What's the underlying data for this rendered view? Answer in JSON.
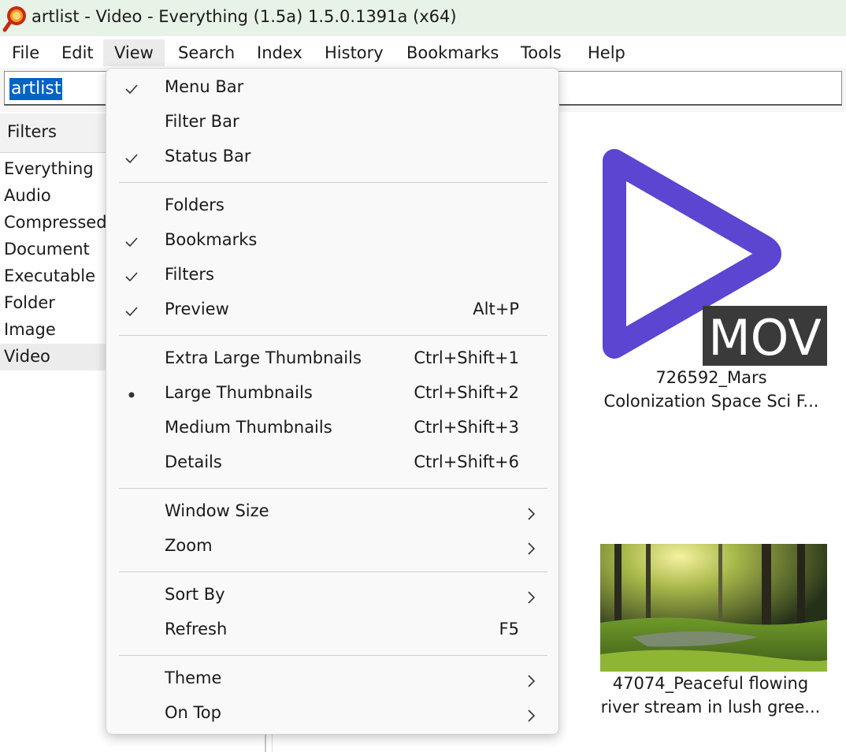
{
  "window": {
    "title": "artlist - Video - Everything (1.5a) 1.5.0.1391a (x64)"
  },
  "menubar": {
    "items": [
      {
        "label": "File"
      },
      {
        "label": "Edit"
      },
      {
        "label": "View"
      },
      {
        "label": "Search"
      },
      {
        "label": "Index"
      },
      {
        "label": "History"
      },
      {
        "label": "Bookmarks"
      },
      {
        "label": "Tools"
      },
      {
        "label": "Help"
      }
    ],
    "active": "View"
  },
  "search": {
    "value": "artlist"
  },
  "filters": {
    "header": "Filters",
    "items": [
      {
        "label": "Everything"
      },
      {
        "label": "Audio"
      },
      {
        "label": "Compressed"
      },
      {
        "label": "Document"
      },
      {
        "label": "Executable"
      },
      {
        "label": "Folder"
      },
      {
        "label": "Image"
      },
      {
        "label": "Video"
      }
    ],
    "selected": "Video"
  },
  "results": [
    {
      "line1": "726592_Mars",
      "line2": "Colonization Space Sci F...",
      "badge": "MOV",
      "icon": "video-play-icon"
    },
    {
      "line1": "47074_Peaceful flowing",
      "line2": "river stream in lush gree..."
    }
  ],
  "view_menu": {
    "sections": [
      [
        {
          "label": "Menu Bar",
          "mark": "check"
        },
        {
          "label": "Filter Bar",
          "mark": ""
        },
        {
          "label": "Status Bar",
          "mark": "check"
        }
      ],
      [
        {
          "label": "Folders",
          "mark": ""
        },
        {
          "label": "Bookmarks",
          "mark": "check"
        },
        {
          "label": "Filters",
          "mark": "check"
        },
        {
          "label": "Preview",
          "mark": "check",
          "accel": "Alt+P"
        }
      ],
      [
        {
          "label": "Extra Large Thumbnails",
          "mark": "",
          "accel": "Ctrl+Shift+1"
        },
        {
          "label": "Large Thumbnails",
          "mark": "bullet",
          "accel": "Ctrl+Shift+2"
        },
        {
          "label": "Medium Thumbnails",
          "mark": "",
          "accel": "Ctrl+Shift+3"
        },
        {
          "label": "Details",
          "mark": "",
          "accel": "Ctrl+Shift+6"
        }
      ],
      [
        {
          "label": "Window Size",
          "mark": "",
          "submenu": true
        },
        {
          "label": "Zoom",
          "mark": "",
          "submenu": true
        }
      ],
      [
        {
          "label": "Sort By",
          "mark": "",
          "submenu": true
        },
        {
          "label": "Refresh",
          "mark": "",
          "accel": "F5"
        }
      ],
      [
        {
          "label": "Theme",
          "mark": "",
          "submenu": true
        },
        {
          "label": "On Top",
          "mark": "",
          "submenu": true
        }
      ]
    ]
  },
  "colors": {
    "accent": "#0063c6",
    "title_bg": "#e7f3e6",
    "play_icon": "#5b45d1",
    "badge_bg": "#3a3a3a"
  }
}
